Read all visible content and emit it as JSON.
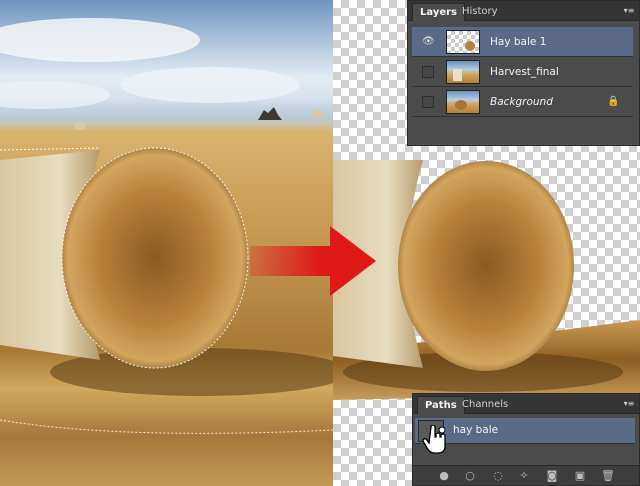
{
  "layers_panel": {
    "tabs": [
      "Layers",
      "History"
    ],
    "layers": [
      {
        "name": "Hay bale 1",
        "visible": true,
        "selected": true,
        "italic": false,
        "locked": false
      },
      {
        "name": "Harvest_final",
        "visible": false,
        "selected": false,
        "italic": false,
        "locked": false
      },
      {
        "name": "Background",
        "visible": false,
        "selected": false,
        "italic": true,
        "locked": true
      }
    ]
  },
  "paths_panel": {
    "tabs": [
      "Paths",
      "Channels"
    ],
    "paths": [
      {
        "name": "hay bale",
        "selected": true
      }
    ],
    "footer_icons": [
      "fill-path-icon",
      "stroke-path-icon",
      "load-selection-icon",
      "make-work-path-icon",
      "add-mask-icon",
      "new-path-icon",
      "delete-path-icon"
    ]
  },
  "colors": {
    "arrow": "#e01818",
    "panel_bg": "#4b4b4b",
    "selected_row": "#5b6b87"
  },
  "icons": {
    "visibility": "eye-icon",
    "lock": "lock-icon",
    "menu": "panel-menu-icon",
    "cursor": "hand-cursor-icon"
  }
}
